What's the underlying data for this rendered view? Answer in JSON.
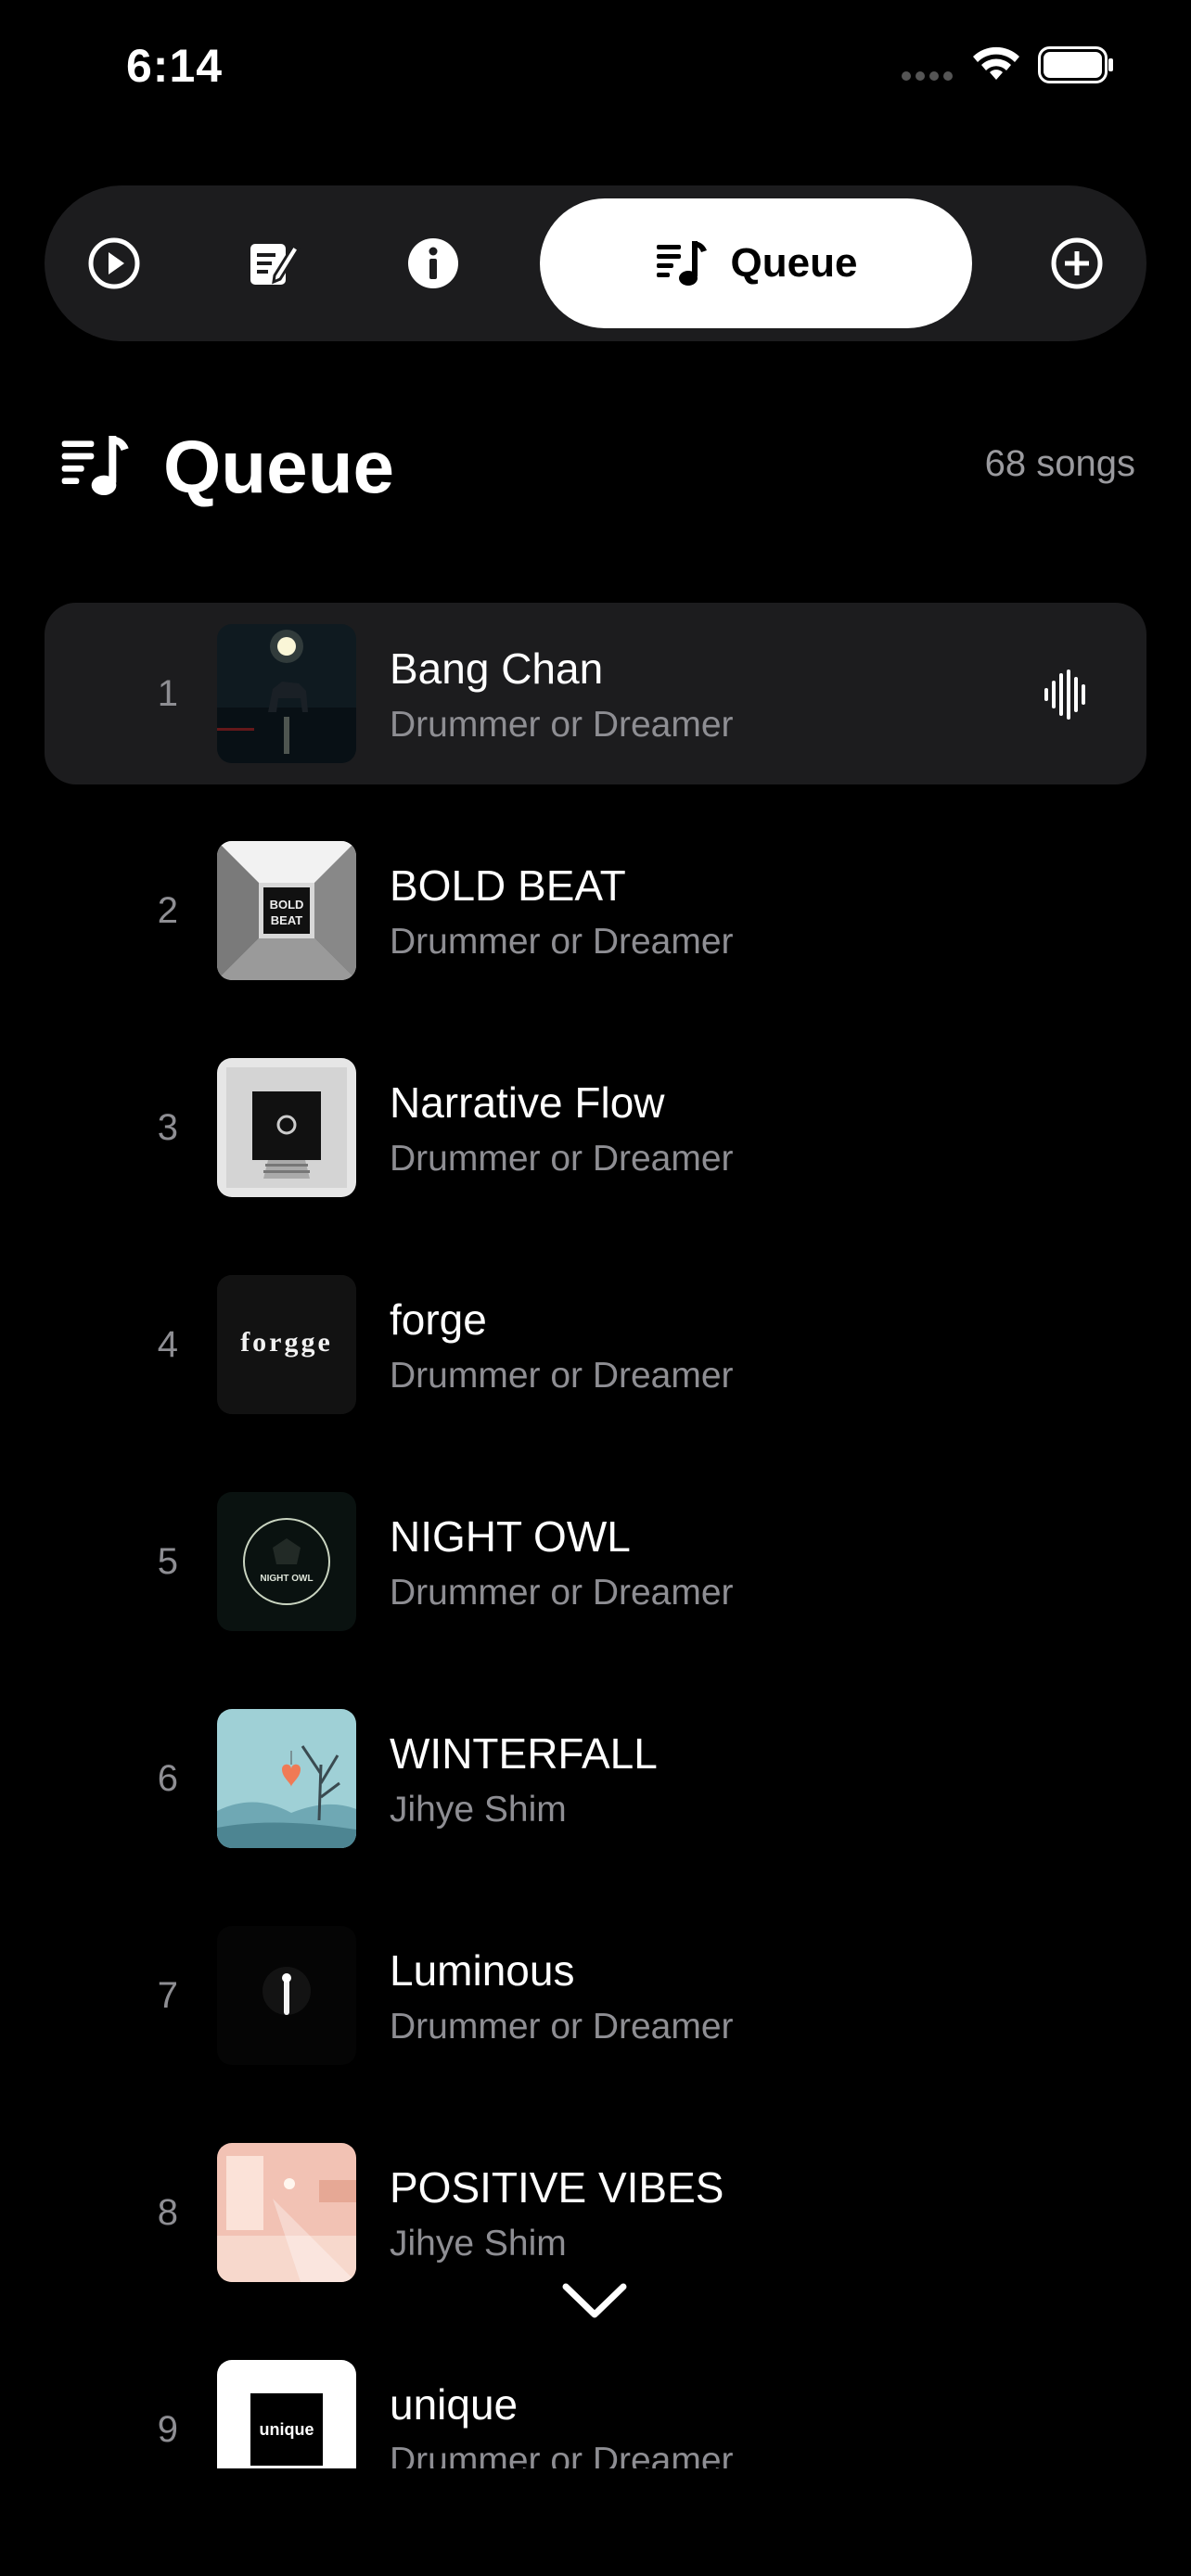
{
  "status_bar": {
    "time": "6:14"
  },
  "tabs": {
    "items": [
      {
        "name": "play-tab",
        "icon": "play-circle-icon"
      },
      {
        "name": "lyrics-tab",
        "icon": "lyrics-edit-icon"
      },
      {
        "name": "info-tab",
        "icon": "info-circle-icon"
      },
      {
        "name": "queue-tab",
        "icon": "queue-music-icon",
        "label": "Queue",
        "active": true
      },
      {
        "name": "add-tab",
        "icon": "plus-circle-icon"
      }
    ]
  },
  "header": {
    "title": "Queue",
    "count": "68 songs"
  },
  "queue": [
    {
      "num": "1",
      "title": "Bang Chan",
      "artist": "Drummer or Dreamer",
      "playing": true
    },
    {
      "num": "2",
      "title": "BOLD BEAT",
      "artist": "Drummer or Dreamer",
      "art_text": "BOLD BEAT"
    },
    {
      "num": "3",
      "title": "Narrative Flow",
      "artist": "Drummer or Dreamer"
    },
    {
      "num": "4",
      "title": "forge",
      "artist": "Drummer or Dreamer",
      "art_text": "forgge"
    },
    {
      "num": "5",
      "title": "NIGHT OWL",
      "artist": "Drummer or Dreamer",
      "art_text": "NIGHT OWL"
    },
    {
      "num": "6",
      "title": "WINTERFALL",
      "artist": "Jihye Shim"
    },
    {
      "num": "7",
      "title": "Luminous",
      "artist": "Drummer or Dreamer"
    },
    {
      "num": "8",
      "title": "POSITIVE VIBES",
      "artist": "Jihye Shim"
    },
    {
      "num": "9",
      "title": "unique",
      "artist": "Drummer or Dreamer",
      "art_text": "unique"
    }
  ],
  "colors": {
    "background": "#000000",
    "card": "#1c1c1e",
    "secondary_text": "#8e8e93",
    "pill": "#ffffff"
  }
}
